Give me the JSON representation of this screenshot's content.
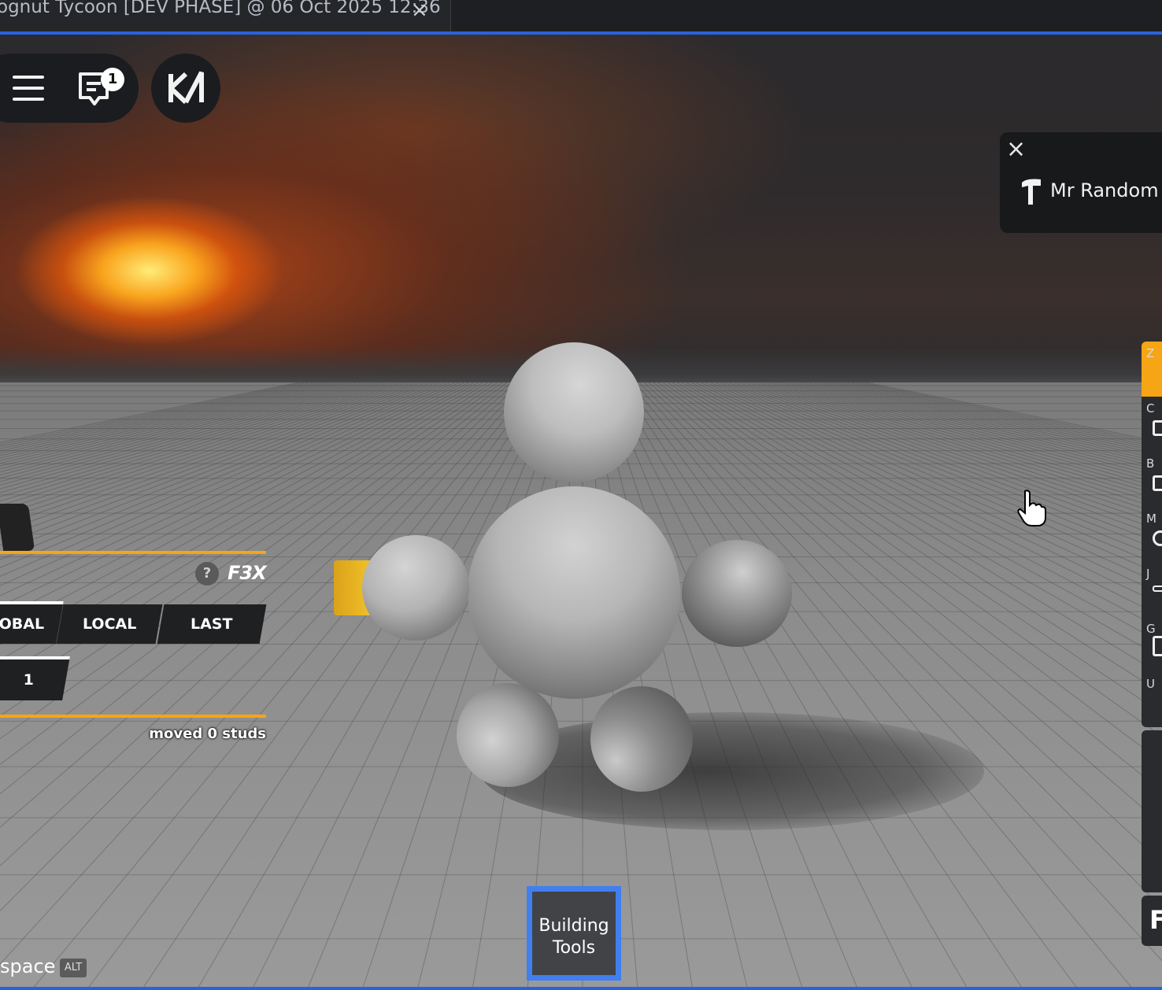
{
  "window": {
    "tab_title": "ognut Tycoon [DEV PHASE] @ 06 Oct 2025 12:36",
    "tab_close": "×"
  },
  "topbar": {
    "chat_badge": "1",
    "icons": [
      "menu-icon",
      "chat-icon",
      "roblox-logo-icon"
    ]
  },
  "notification": {
    "close_icon": "×",
    "text": "Mr Random",
    "icon": "hammer-icon"
  },
  "toolbar": {
    "keys": [
      "Z",
      "C",
      "B",
      "M",
      "J",
      "G",
      "U"
    ],
    "active_key": "Z",
    "extra_label": "F",
    "accent": "#f6a514"
  },
  "f3x": {
    "help": "?",
    "logo": "F3X",
    "axis": [
      "OBAL",
      "LOCAL",
      "LAST"
    ],
    "increment": "1",
    "status": "moved 0 studs"
  },
  "hotbar": {
    "label_line1": "Building",
    "label_line2": "Tools",
    "border_color": "#3f7ff0"
  },
  "hint": {
    "text": "space",
    "key": "ALT"
  }
}
